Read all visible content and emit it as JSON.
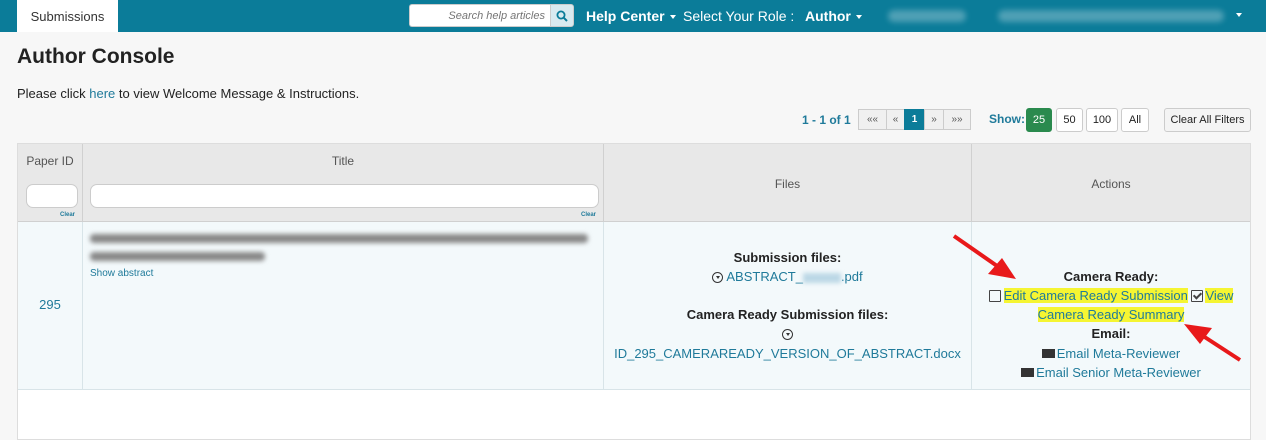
{
  "nav": {
    "tab_submissions": "Submissions",
    "search_placeholder": "Search help articles",
    "help_center": "Help Center",
    "role_label": "Select Your Role :",
    "role_value": "Author"
  },
  "page": {
    "title": "Author Console",
    "welcome_prefix": "Please click ",
    "welcome_link": "here",
    "welcome_suffix": " to view Welcome Message & Instructions."
  },
  "pagination": {
    "count": "1 - 1 of 1",
    "buttons": [
      "««",
      "«",
      "1",
      "»",
      "»»"
    ],
    "show_label": "Show:",
    "show_options": [
      "25",
      "50",
      "100",
      "All"
    ],
    "clear_filters": "Clear All Filters"
  },
  "table": {
    "headers": {
      "paper_id": "Paper ID",
      "title": "Title",
      "files": "Files",
      "actions": "Actions"
    },
    "clear_label": "Clear",
    "row": {
      "paper_id": "295",
      "show_abstract": "Show abstract",
      "submission_files_label": "Submission files:",
      "submission_file": "ABSTRACT_",
      "submission_file_ext": ".pdf",
      "camera_files_label": "Camera Ready Submission files:",
      "camera_file": "ID_295_CAMERAREADY_VERSION_OF_ABSTRACT.docx",
      "camera_ready_label": "Camera Ready:",
      "edit_camera_ready": "Edit Camera Ready Submission",
      "view_camera_ready_1": "View",
      "view_camera_ready_2": "Camera Ready Summary",
      "email_label": "Email:",
      "email_meta": "Email Meta-Reviewer",
      "email_senior": "Email Senior Meta-Reviewer"
    }
  },
  "colors": {
    "nav_bg": "#0b7c99",
    "link": "#1f7a9a",
    "highlight": "#f5f532",
    "annotation_arrow": "#e8191a",
    "show_active": "#2a8a4e"
  }
}
